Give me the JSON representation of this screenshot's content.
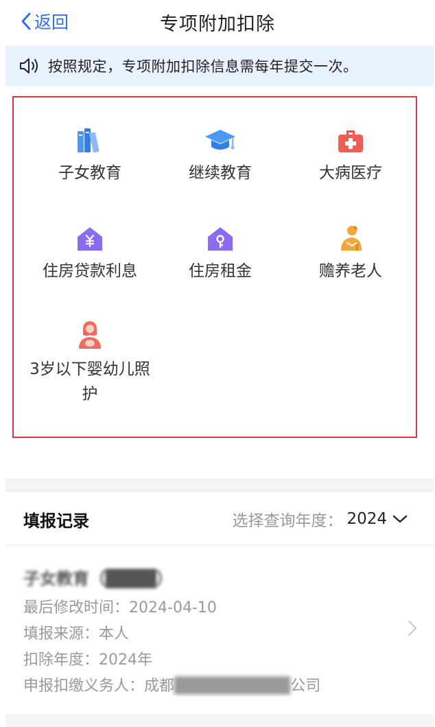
{
  "nav": {
    "back_label": "返回",
    "title": "专项附加扣除"
  },
  "notice": {
    "text": "按照规定，专项附加扣除信息需每年提交一次。"
  },
  "categories": [
    {
      "label": "子女教育",
      "icon": "books-icon"
    },
    {
      "label": "继续教育",
      "icon": "graduation-cap-icon"
    },
    {
      "label": "大病医疗",
      "icon": "medical-kit-icon"
    },
    {
      "label": "住房贷款利息",
      "icon": "house-yen-icon"
    },
    {
      "label": "住房租金",
      "icon": "house-key-icon"
    },
    {
      "label": "赡养老人",
      "icon": "elder-icon"
    },
    {
      "label": "3岁以下婴幼儿照",
      "label2": "护",
      "icon": "mother-baby-icon"
    }
  ],
  "records": {
    "heading": "填报记录",
    "year_select_label": "选择查询年度：",
    "year_value": "2024",
    "item": {
      "name": "子女教育（████）",
      "modified_label": "最后修改时间：",
      "modified_value": "2024-04-10",
      "source_label": "填报来源：",
      "source_value": "本人",
      "deduct_year_label": "扣除年度：",
      "deduct_year_value": "2024年",
      "agent_label": "申报扣缴义务人：",
      "agent_value_prefix": "成都",
      "agent_value_masked": "██████████",
      "agent_value_suffix": "公司"
    }
  },
  "colors": {
    "accent": "#2f6ff0",
    "notice_bg": "#e8f1fe",
    "border_highlight": "#d03a40"
  }
}
